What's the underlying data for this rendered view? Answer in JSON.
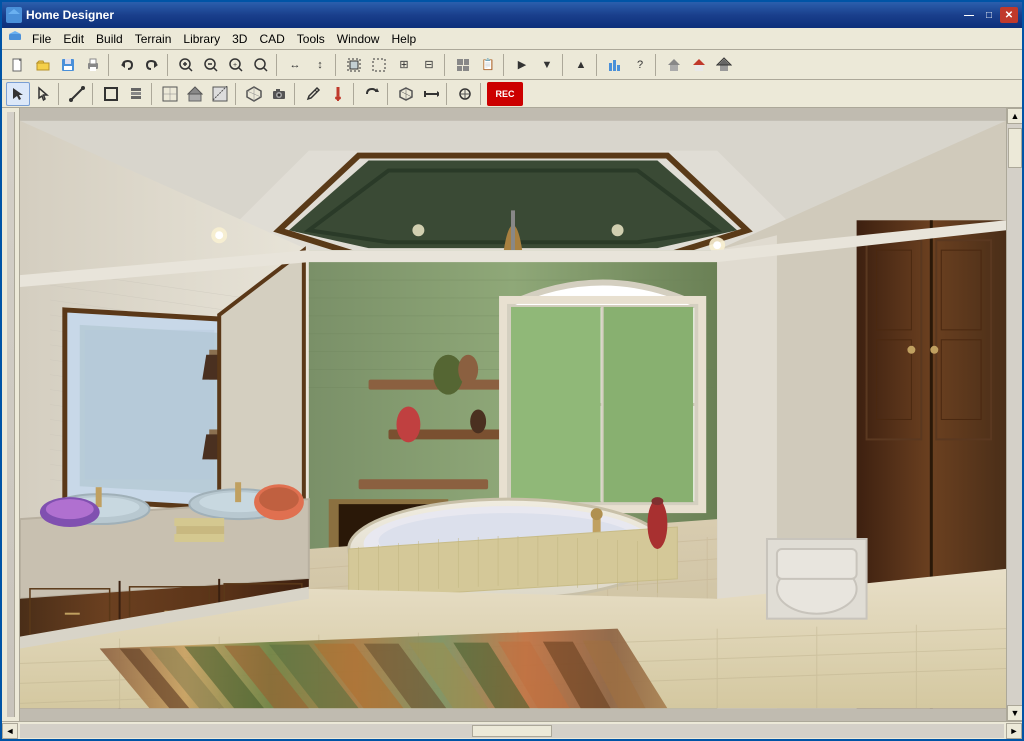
{
  "window": {
    "title": "Home Designer",
    "icon": "🏠"
  },
  "title_buttons": {
    "minimize": "—",
    "maximize": "□",
    "close": "✕"
  },
  "menu": {
    "items": [
      "File",
      "Edit",
      "Build",
      "Terrain",
      "Library",
      "3D",
      "CAD",
      "Tools",
      "Window",
      "Help"
    ]
  },
  "toolbar1": {
    "buttons": [
      "📄",
      "📂",
      "💾",
      "🖨",
      "↩",
      "↪",
      "🔍",
      "🔍",
      "🔍",
      "🔎",
      "↔",
      "↕",
      "🔲",
      "⊞",
      "⊟",
      "~",
      "📋",
      "📋",
      "▶",
      "?",
      "🏠",
      "🏠",
      "🏠"
    ]
  },
  "toolbar2": {
    "buttons": [
      "↖",
      "↙",
      "∿",
      "▦",
      "▣",
      "⬜",
      "⬜",
      "⊞",
      "⬛",
      "🖊",
      "🖊",
      "🔄",
      "🔧",
      "🔴"
    ]
  },
  "status": {
    "scrollbar_v": true,
    "scrollbar_h": true
  }
}
